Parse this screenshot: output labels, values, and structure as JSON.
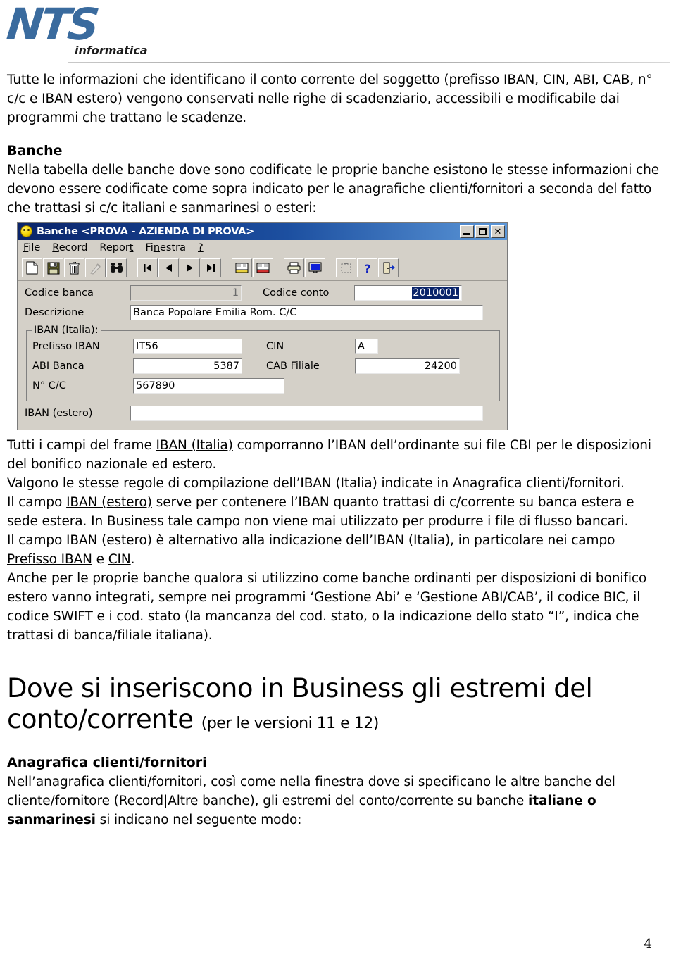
{
  "logo": {
    "mark": "NTS",
    "subtitle": "informatica"
  },
  "intro_paragraph": "Tutte le informazioni che identificano il conto corrente del soggetto (prefisso IBAN, CIN, ABI, CAB, n° c/c e IBAN estero) vengono conservati nelle righe di scadenziario, accessibili e modificabile dai programmi che trattano le scadenze.",
  "banche_heading": "Banche",
  "banche_paragraph": "Nella tabella delle banche dove sono codificate le proprie banche esistono le stesse informazioni che devono essere codificate come sopra indicato per le anagrafiche clienti/fornitori a seconda del fatto che trattasi si c/c italiani e sanmarinesi o esteri:",
  "window": {
    "title": "Banche <PROVA - AZIENDA DI PROVA>",
    "title_icon": "app-icon",
    "buttons": {
      "minimize": "minimize",
      "maximize": "maximize",
      "close": "close"
    },
    "menu": [
      {
        "label": "File",
        "accel": "F"
      },
      {
        "label": "Record",
        "accel": "R"
      },
      {
        "label": "Report",
        "accel": "t"
      },
      {
        "label": "Finestra",
        "accel": "n"
      },
      {
        "label": "?",
        "accel": "?"
      }
    ],
    "toolbar": [
      {
        "name": "new-record-icon",
        "tip": "Nuovo"
      },
      {
        "name": "save-icon",
        "tip": "Salva"
      },
      {
        "name": "delete-icon",
        "tip": "Elimina"
      },
      {
        "name": "clear-icon",
        "tip": "Annulla"
      },
      {
        "name": "find-icon",
        "tip": "Cerca"
      },
      {
        "name": "first-record-icon",
        "tip": "Primo"
      },
      {
        "name": "previous-record-icon",
        "tip": "Precedente"
      },
      {
        "name": "next-record-icon",
        "tip": "Successivo"
      },
      {
        "name": "last-record-icon",
        "tip": "Ultimo"
      },
      {
        "name": "ledger-yellow-icon",
        "tip": "Lista"
      },
      {
        "name": "ledger-red-icon",
        "tip": "Lista 2"
      },
      {
        "name": "print-icon",
        "tip": "Stampa"
      },
      {
        "name": "preview-monitor-icon",
        "tip": "Anteprima"
      },
      {
        "name": "select-area-icon",
        "tip": "Seleziona"
      },
      {
        "name": "help-icon",
        "tip": "Guida"
      },
      {
        "name": "exit-icon",
        "tip": "Esci"
      }
    ],
    "fields": {
      "codice_banca_label": "Codice banca",
      "codice_banca_value": "1",
      "codice_conto_label": "Codice conto",
      "codice_conto_value": "2010001",
      "descrizione_label": "Descrizione",
      "descrizione_value": "Banca Popolare Emilia Rom. C/C",
      "group_iban_italia_legend": "IBAN (Italia):",
      "prefisso_iban_label": "Prefisso IBAN",
      "prefisso_iban_value": "IT56",
      "cin_label": "CIN",
      "cin_value": "A",
      "abi_banca_label": "ABI Banca",
      "abi_banca_value": "5387",
      "cab_filiale_label": "CAB Filiale",
      "cab_filiale_value": "24200",
      "nc_c_label": "N° C/C",
      "nc_c_value": "567890",
      "iban_estero_label": "IBAN (estero)",
      "iban_estero_value": ""
    }
  },
  "body_paragraphs": {
    "p1_a": "Tutti i campi del frame ",
    "p1_link": "IBAN (Italia)",
    "p1_b": " comporranno l’IBAN dell’ordinante sui file CBI per le disposizioni del bonifico nazionale ed estero.",
    "p2": "Valgono le stesse regole di compilazione dell’IBAN (Italia) indicate in Anagrafica clienti/fornitori.",
    "p3_a": "Il campo ",
    "p3_link": "IBAN (estero)",
    "p3_b": " serve per contenere l’IBAN quanto trattasi di c/corrente su banca estera e sede estera. In Business tale campo non viene mai utilizzato per produrre i file di flusso bancari.",
    "p4_a": "Il campo IBAN (estero) è alternativo alla indicazione dell’IBAN (Italia), in particolare nei campo ",
    "p4_link1": "Prefisso IBAN",
    "p4_mid": " e ",
    "p4_link2": "CIN",
    "p4_end": ".",
    "p5": "Anche per le proprie banche qualora si utilizzino come banche ordinanti per disposizioni di bonifico estero vanno integrati, sempre nei programmi ‘Gestione Abi’ e ‘Gestione ABI/CAB’, il codice BIC, il codice SWIFT e i cod. stato (la mancanza del cod. stato, o la indicazione dello stato “I”, indica che trattasi di banca/filiale italiana)."
  },
  "section_heading": {
    "main": "Dove si inseriscono in Business gli estremi del conto/corrente",
    "note": "(per le versioni 11 e 12)"
  },
  "anagrafica": {
    "heading": "Anagrafica clienti/fornitori",
    "p_a": "Nell’anagrafica clienti/fornitori, così come nella finestra dove si specificano le altre banche del cliente/fornitore (Record|Altre banche), gli estremi del conto/corrente su banche ",
    "p_bold": "italiane o sanmarinesi",
    "p_b": " si indicano nel seguente modo:"
  },
  "page_number": "4",
  "colors": {
    "logo_blue": "#3a6b9e",
    "titlebar_start": "#0a246a",
    "titlebar_end": "#5c97d8",
    "dialog_face": "#d4d0c8",
    "selection": "#0a246a"
  }
}
